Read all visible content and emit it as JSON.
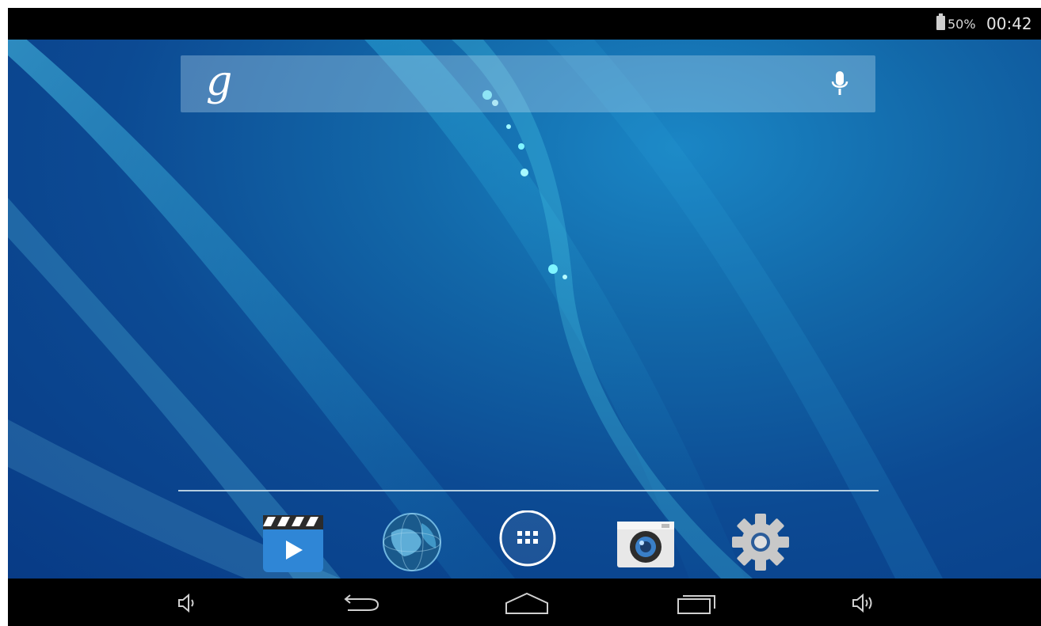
{
  "status_bar": {
    "battery_percent": "50%",
    "clock": "00:42"
  },
  "search": {
    "logo": "g",
    "mic_icon": "microphone-icon"
  },
  "dock": {
    "apps": [
      {
        "name": "video-player-app-icon"
      },
      {
        "name": "browser-globe-app-icon"
      },
      {
        "name": "app-drawer-icon"
      },
      {
        "name": "camera-app-icon"
      },
      {
        "name": "settings-gear-app-icon"
      }
    ]
  },
  "nav": {
    "buttons": [
      "volume-down-icon",
      "back-icon",
      "home-icon",
      "recent-apps-icon",
      "volume-up-icon"
    ]
  },
  "colors": {
    "wallpaper_dark": "#083b86",
    "wallpaper_light": "#1a86c5",
    "accent_cyan": "#3be3f5"
  }
}
